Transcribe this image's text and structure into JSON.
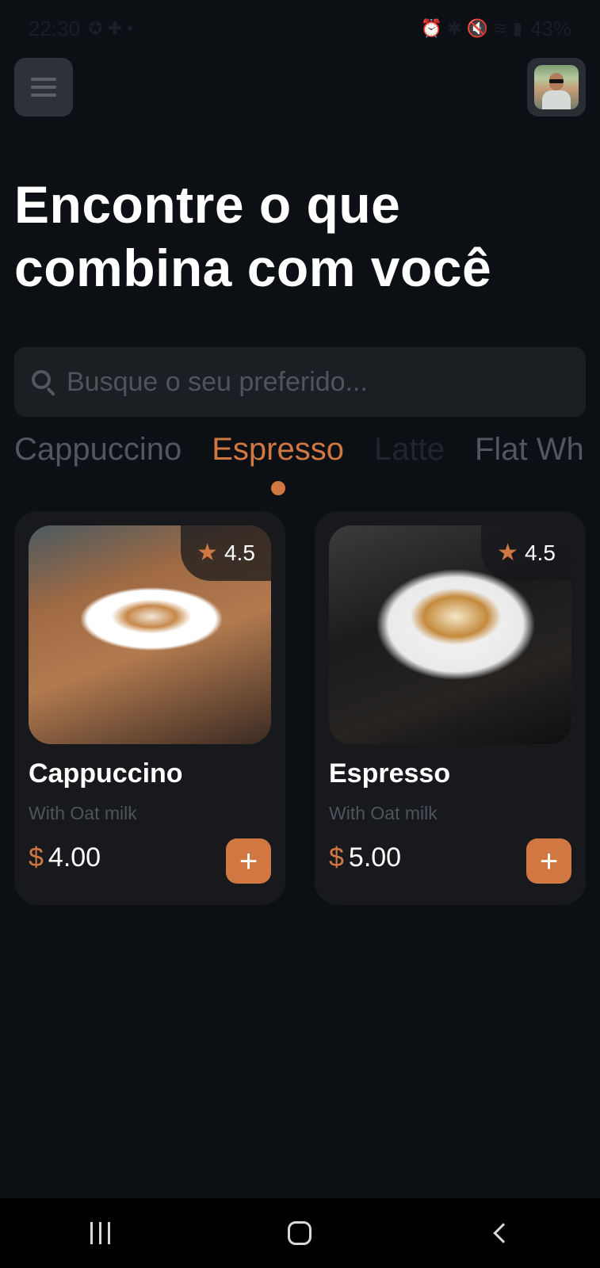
{
  "status_bar": {
    "time": "22:30",
    "battery": "43%"
  },
  "header": {
    "menu_icon": "hamburger-menu-icon",
    "avatar_icon": "user-avatar"
  },
  "title": {
    "line1": "Encontre o que",
    "line2": "combina com você"
  },
  "search": {
    "placeholder": "Busque o seu preferido...",
    "value": ""
  },
  "tabs": [
    {
      "label": "Cappuccino",
      "active": false
    },
    {
      "label": "Espresso",
      "active": true
    },
    {
      "label": "Latte",
      "active": false
    },
    {
      "label": "Flat White",
      "active": false
    }
  ],
  "products": [
    {
      "name": "Cappuccino",
      "subtitle": "With Oat milk",
      "rating": "4.5",
      "currency": "$",
      "price": "4.00"
    },
    {
      "name": "Espresso",
      "subtitle": "With Oat milk",
      "rating": "4.5",
      "currency": "$",
      "price": "5.00"
    }
  ],
  "colors": {
    "background": "#0c0f14",
    "accent": "#d17842",
    "card": "#17191d",
    "search_bg": "#1b1e23"
  },
  "icons": {
    "search": "search-icon",
    "star": "star-icon",
    "add": "plus-icon",
    "nav_recents": "recents-icon",
    "nav_home": "home-icon",
    "nav_back": "back-icon"
  }
}
